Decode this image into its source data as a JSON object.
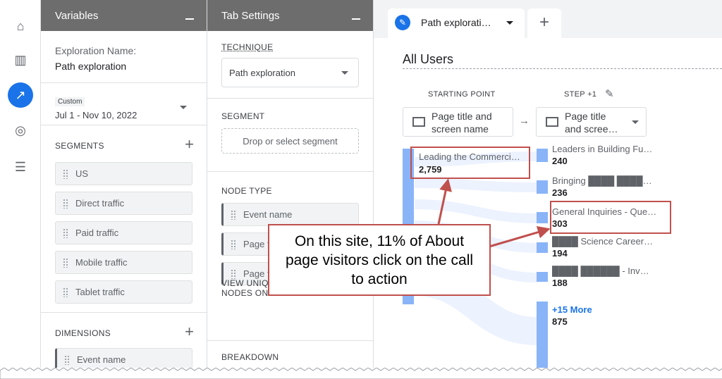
{
  "nav": {
    "items": [
      "home-icon",
      "reports-icon",
      "explore-icon",
      "advertising-icon",
      "configure-icon"
    ]
  },
  "variables": {
    "title": "Variables",
    "exploration_label": "Exploration Name:",
    "exploration_name": "Path exploration",
    "date_badge": "Custom",
    "date_range": "Jul 1 - Nov 10, 2022",
    "segments_label": "SEGMENTS",
    "segments": [
      "US",
      "Direct traffic",
      "Paid traffic",
      "Mobile traffic",
      "Tablet traffic"
    ],
    "dimensions_label": "DIMENSIONS",
    "dimensions": [
      "Event name"
    ]
  },
  "tab_settings": {
    "title": "Tab Settings",
    "technique_label": "TECHNIQUE",
    "technique": "Path exploration",
    "segment_label": "SEGMENT",
    "segment_placeholder": "Drop or select segment",
    "node_type_label": "NODE TYPE",
    "node_types": [
      "Event name",
      "Page t",
      "Page t"
    ],
    "unique_nodes_label": "VIEW UNIQUE NODES ONLY",
    "unique_nodes_on": true,
    "breakdown_label": "BREAKDOWN"
  },
  "main": {
    "tab_label": "Path explorati…",
    "segment_title": "All Users",
    "starting_point_label": "STARTING POINT",
    "step_label": "STEP +1",
    "start_dim": "Page title and screen name",
    "step_dim": "Page title and scree…",
    "start_node": {
      "label": "Leading the Commerci…",
      "value": "2,759"
    },
    "step_nodes": [
      {
        "label": "Leaders in Building Fu…",
        "value": "240"
      },
      {
        "label": "Bringing ████ ████…",
        "value": "236"
      },
      {
        "label": "General Inquiries - Que…",
        "value": "303"
      },
      {
        "label": "████ Science Career…",
        "value": "194"
      },
      {
        "label": "████ ██████ - Inv…",
        "value": "188"
      }
    ],
    "more": {
      "label": "+15 More",
      "value": "875"
    }
  },
  "annotation": {
    "text": "On this site, 11% of About page visitors click on the call to action"
  },
  "colors": {
    "accent": "#1a73e8",
    "node": "#8ab4f8",
    "annotation": "#c0504d"
  }
}
